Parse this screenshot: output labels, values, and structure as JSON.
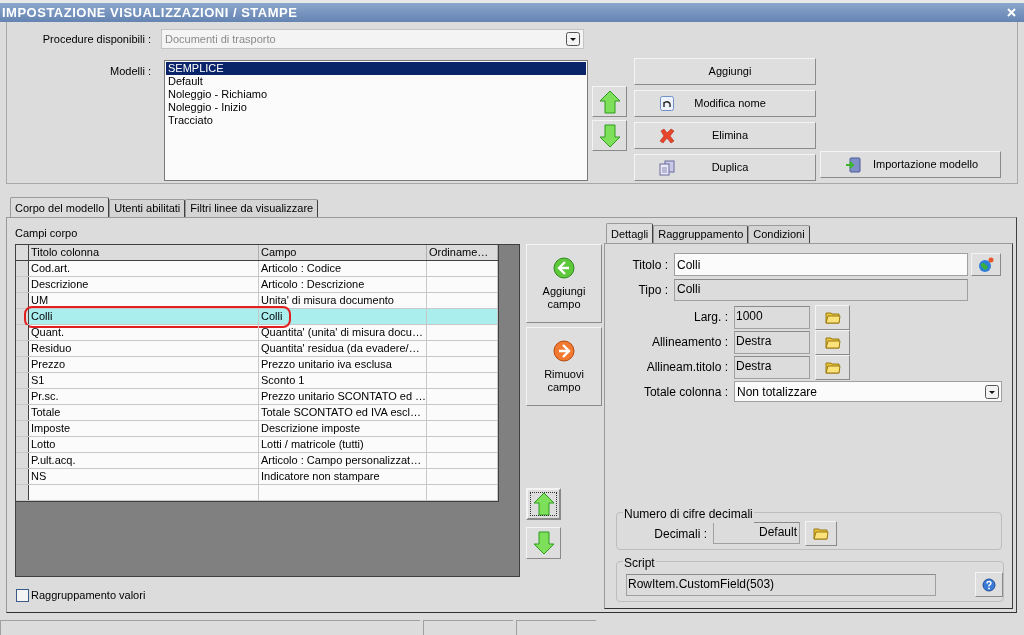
{
  "window": {
    "title": "IMPOSTAZIONE VISUALIZZAZIONI / STAMPE"
  },
  "procedure": {
    "label": "Procedure disponibili :",
    "value": "Documenti di trasporto",
    "disabled": true
  },
  "models": {
    "label": "Modelli :",
    "items": [
      {
        "label": "SEMPLICE",
        "selected": true
      },
      {
        "label": "Default",
        "selected": false
      },
      {
        "label": "Noleggio - Richiamo",
        "selected": false
      },
      {
        "label": "Noleggio - Inizio",
        "selected": false
      },
      {
        "label": "Tracciato",
        "selected": false
      }
    ]
  },
  "model_buttons": [
    {
      "label": "Aggiungi",
      "kind": "add"
    },
    {
      "label": "Modifica nome",
      "kind": "rename"
    },
    {
      "label": "Elimina",
      "kind": "delete"
    },
    {
      "label": "Duplica",
      "kind": "duplicate"
    }
  ],
  "import_button": {
    "label": "Importazione modello"
  },
  "tabs": [
    {
      "label": "Corpo del modello",
      "selected": true
    },
    {
      "label": "Utenti abilitati",
      "selected": false
    },
    {
      "label": "Filtri linee da visualizzare",
      "selected": false
    }
  ],
  "fields_label": "Campi corpo",
  "table": {
    "columns": [
      "Titolo colonna",
      "Campo",
      "Ordiname…"
    ],
    "rows": [
      {
        "title": "Cod.art.",
        "field": "Articolo : Codice",
        "selected": false,
        "circled": false
      },
      {
        "title": "Descrizione",
        "field": "Articolo : Descrizione",
        "selected": false,
        "circled": false
      },
      {
        "title": "UM",
        "field": "Unita' di misura documento",
        "selected": false,
        "circled": false
      },
      {
        "title": "Colli",
        "field": "Colli",
        "selected": true,
        "circled": true
      },
      {
        "title": "Quant.",
        "field": "Quantita' (unita' di misura docu…",
        "selected": false,
        "circled": false
      },
      {
        "title": "Residuo",
        "field": "Quantita' residua (da evadere/…",
        "selected": false,
        "circled": false
      },
      {
        "title": "Prezzo",
        "field": "Prezzo unitario iva esclusa",
        "selected": false,
        "circled": false
      },
      {
        "title": "S1",
        "field": "Sconto 1",
        "selected": false,
        "circled": false
      },
      {
        "title": "Pr.sc.",
        "field": "Prezzo unitario SCONTATO ed …",
        "selected": false,
        "circled": false
      },
      {
        "title": "Totale",
        "field": "Totale SCONTATO ed IVA escl…",
        "selected": false,
        "circled": false
      },
      {
        "title": "Imposte",
        "field": "Descrizione imposte",
        "selected": false,
        "circled": false
      },
      {
        "title": "Lotto",
        "field": "Lotti / matricole (tutti)",
        "selected": false,
        "circled": false
      },
      {
        "title": "P.ult.acq.",
        "field": "Articolo : Campo personalizzat…",
        "selected": false,
        "circled": false
      },
      {
        "title": "NS",
        "field": "Indicatore non stampare",
        "selected": false,
        "circled": false
      }
    ]
  },
  "field_buttons": [
    {
      "label": "Aggiungi campo",
      "kind": "add"
    },
    {
      "label": "Rimuovi campo",
      "kind": "remove"
    }
  ],
  "grouping_values": {
    "label": "Raggruppamento valori",
    "checked": false
  },
  "detail_tabs": [
    {
      "label": "Dettagli",
      "selected": true
    },
    {
      "label": "Raggruppamento",
      "selected": false
    },
    {
      "label": "Condizioni",
      "selected": false
    }
  ],
  "details": {
    "title_label": "Titolo :",
    "title_value": "Colli",
    "type_label": "Tipo :",
    "type_value": "Colli",
    "props": [
      {
        "label": "Larg. :",
        "value": "1000"
      },
      {
        "label": "Allineamento :",
        "value": "Destra"
      },
      {
        "label": "Allineam.titolo :",
        "value": "Destra"
      }
    ],
    "total": {
      "label": "Totale colonna :",
      "value": "Non totalizzare"
    }
  },
  "decimals": {
    "legend": "Numero di cifre decimali",
    "label": "Decimali :",
    "value": "Default"
  },
  "script": {
    "legend": "Script",
    "value": "RowItem.CustomField(503)"
  }
}
